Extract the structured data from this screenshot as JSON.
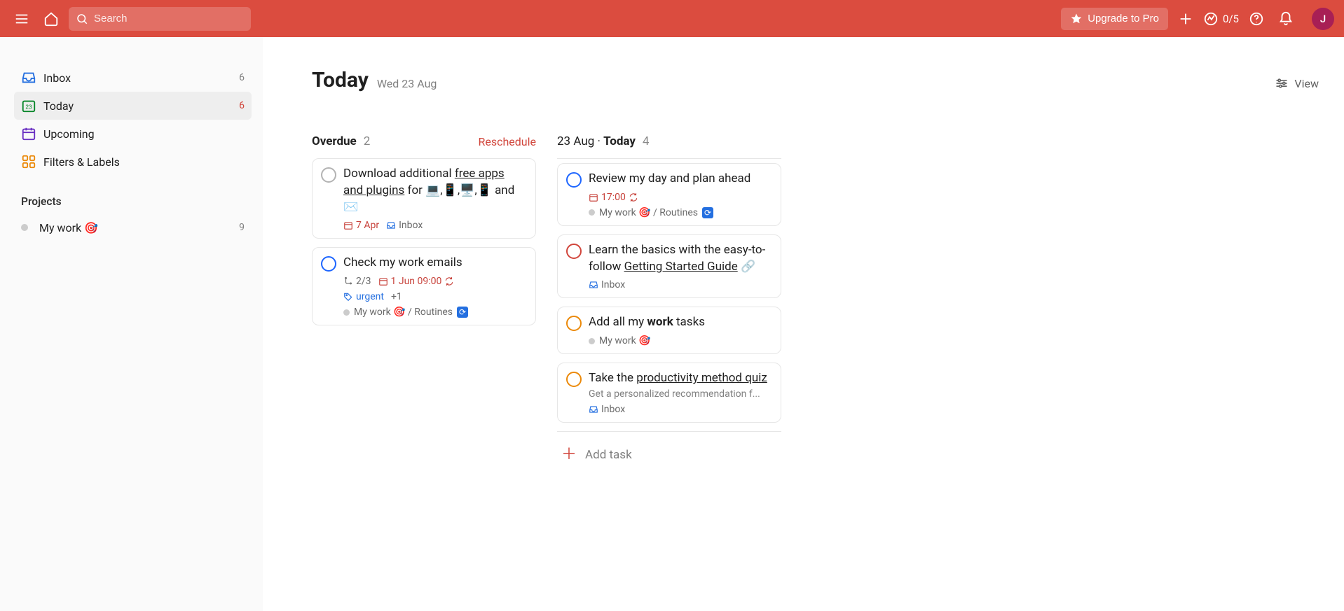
{
  "topbar": {
    "search_placeholder": "Search",
    "upgrade_label": "Upgrade to Pro",
    "karma_count": "0/5",
    "avatar_initial": "J"
  },
  "sidebar": {
    "items": [
      {
        "key": "inbox",
        "label": "Inbox",
        "count": "6"
      },
      {
        "key": "today",
        "label": "Today",
        "count": "6",
        "active": true
      },
      {
        "key": "upcoming",
        "label": "Upcoming",
        "count": ""
      },
      {
        "key": "filters",
        "label": "Filters & Labels",
        "count": ""
      }
    ],
    "projects_title": "Projects",
    "projects": [
      {
        "name": "My work",
        "emoji": "🎯",
        "count": "9"
      }
    ]
  },
  "page": {
    "title": "Today",
    "date": "Wed 23 Aug",
    "view_label": "View"
  },
  "columns": {
    "overdue": {
      "title": "Overdue",
      "count": "2",
      "reschedule_label": "Reschedule",
      "cards": [
        {
          "ring": "grey",
          "title_pre": "Download additional ",
          "title_link": "free apps and plugins",
          "title_post": " for 💻,📱,🖥️,📱 and ✉️",
          "date": "7 Apr",
          "project_inbox": "Inbox"
        },
        {
          "ring": "blue",
          "title_plain": "Check my work emails",
          "subtasks": "2/3",
          "date": "1 Jun 09:00",
          "recur": true,
          "tag": "urgent",
          "tag_extra": "+1",
          "project_path": "My work 🎯 / Routines",
          "project_recur_badge": true
        }
      ]
    },
    "today": {
      "title_pre": "23 Aug · ",
      "title_bold": "Today",
      "count": "4",
      "add_task_label": "Add task",
      "cards": [
        {
          "ring": "blue",
          "title_plain": "Review my day and plan ahead",
          "time": "17:00",
          "recur": true,
          "project_path": "My work 🎯 / Routines",
          "project_recur_badge": true
        },
        {
          "ring": "red",
          "title_pre": "Learn the basics with the easy-to-follow ",
          "title_link": "Getting Started Guide",
          "title_post": " ",
          "link_icon": true,
          "project_inbox": "Inbox"
        },
        {
          "ring": "orange",
          "title_html_pre": "Add all my ",
          "title_bold_word": "work",
          "title_html_post": " tasks",
          "project_path": "My work 🎯"
        },
        {
          "ring": "orange",
          "title_pre": "Take the ",
          "title_link": "productivity method quiz",
          "desc": "Get a personalized recommendation f...",
          "project_inbox": "Inbox"
        }
      ]
    }
  }
}
